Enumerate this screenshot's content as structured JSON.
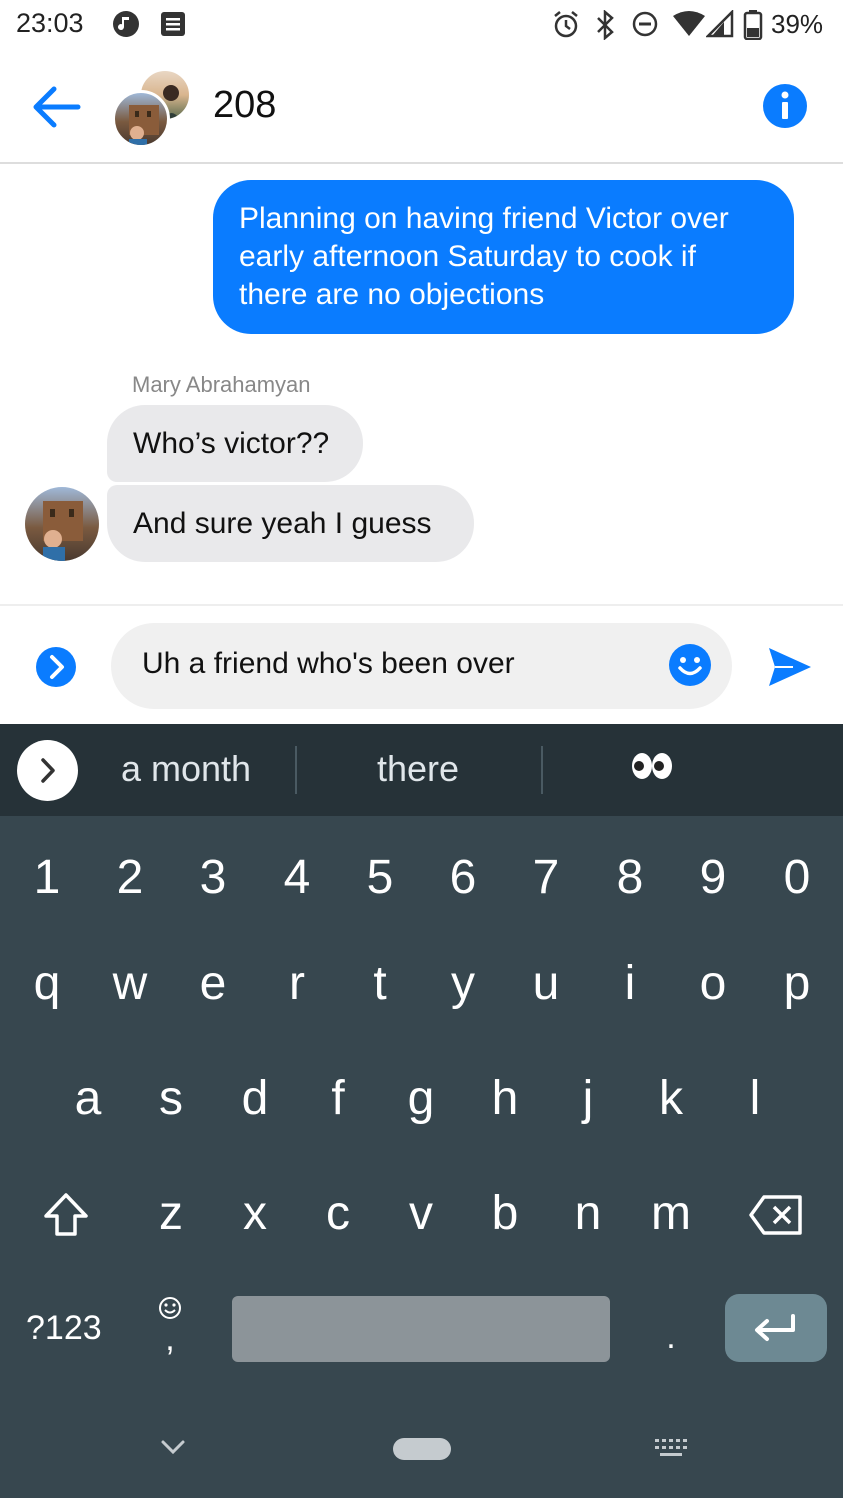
{
  "status_bar": {
    "time": "23:03",
    "battery": "39%",
    "icons": [
      "music-note-icon",
      "notification-icon",
      "alarm-icon",
      "bluetooth-icon",
      "do-not-disturb-icon",
      "wifi-icon",
      "signal-icon",
      "battery-icon"
    ]
  },
  "header": {
    "title": "208",
    "back_icon": "back-arrow-icon",
    "info_icon": "info-icon"
  },
  "messages": [
    {
      "direction": "outgoing",
      "text": "Planning on having friend Victor over early afternoon Saturday to cook if there are no objections"
    },
    {
      "direction": "incoming",
      "sender": "Mary Abrahamyan",
      "text": "Who’s victor??"
    },
    {
      "direction": "incoming",
      "sender": "Mary Abrahamyan",
      "text": "And sure yeah I guess"
    }
  ],
  "composer": {
    "value": "Uh a friend who's been over",
    "accent": "#0a7cff"
  },
  "keyboard": {
    "suggestions": [
      "a month",
      "there",
      "👀"
    ],
    "row_numbers": [
      "1",
      "2",
      "3",
      "4",
      "5",
      "6",
      "7",
      "8",
      "9",
      "0"
    ],
    "row1": [
      "q",
      "w",
      "e",
      "r",
      "t",
      "y",
      "u",
      "i",
      "o",
      "p"
    ],
    "row2": [
      "a",
      "s",
      "d",
      "f",
      "g",
      "h",
      "j",
      "k",
      "l"
    ],
    "row3": [
      "z",
      "x",
      "c",
      "v",
      "b",
      "n",
      "m"
    ],
    "symbols_label": "?123",
    "comma_label": ",",
    "period_label": "."
  }
}
